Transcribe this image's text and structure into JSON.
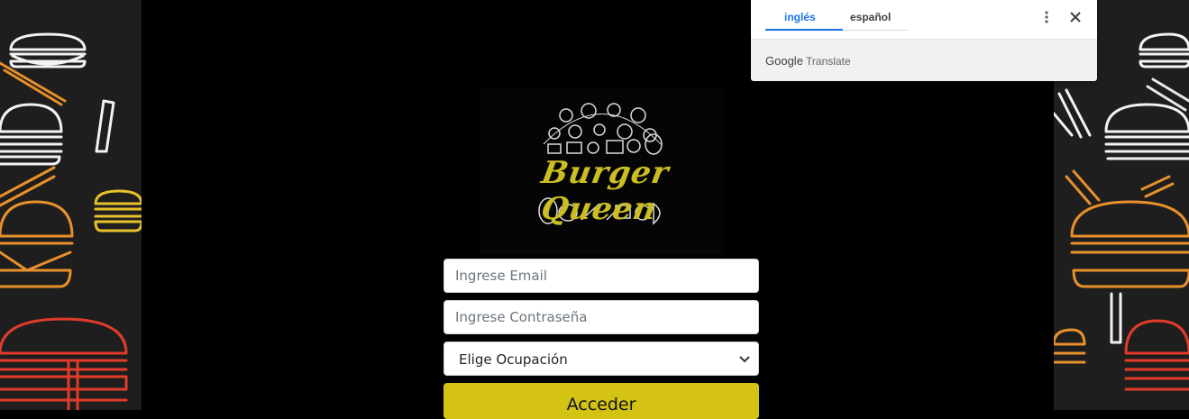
{
  "translate_bar": {
    "tabs": [
      {
        "label": "inglés",
        "active": true
      },
      {
        "label": "español",
        "active": false
      }
    ],
    "brand_google": "Google",
    "brand_product": "Translate",
    "accent_color": "#1a73e8"
  },
  "logo": {
    "text": "Burger Queen",
    "color": "#cbbe22"
  },
  "login_form": {
    "email_placeholder": "Ingrese Email",
    "password_placeholder": "Ingrese Contraseña",
    "occupation_selected": "Elige Ocupación",
    "submit_label": "Acceder",
    "submit_color": "#d4c313"
  },
  "icons": [
    "more-vert-icon",
    "close-icon",
    "chevron-down-icon",
    "burger-icon",
    "fries-icon"
  ]
}
